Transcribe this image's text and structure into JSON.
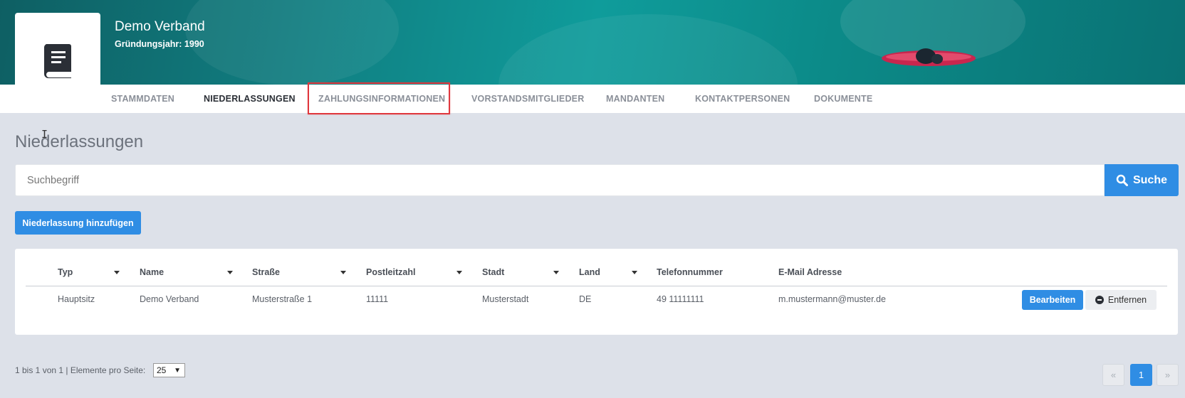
{
  "org": {
    "name": "Demo Verband",
    "founded": "Gründungsjahr: 1990"
  },
  "tabs": [
    {
      "label": "STAMMDATEN"
    },
    {
      "label": "NIEDERLASSUNGEN",
      "active": true
    },
    {
      "label": "ZAHLUNGSINFORMATIONEN",
      "highlighted": true
    },
    {
      "label": "VORSTANDSMITGLIEDER"
    },
    {
      "label": "MANDANTEN"
    },
    {
      "label": "KONTAKTPERSONEN"
    },
    {
      "label": "DOKUMENTE"
    }
  ],
  "page": {
    "title": "Niederlassungen"
  },
  "search": {
    "placeholder": "Suchbegriff",
    "button_label": "Suche"
  },
  "add_button_label": "Niederlassung hinzufügen",
  "table": {
    "columns": [
      "Typ",
      "Name",
      "Straße",
      "Postleitzahl",
      "Stadt",
      "Land",
      "Telefonnummer",
      "E-Mail Adresse"
    ],
    "rows": [
      {
        "typ": "Hauptsitz",
        "name": "Demo Verband",
        "strasse": "Musterstraße 1",
        "plz": "11111",
        "stadt": "Musterstadt",
        "land": "DE",
        "telefon": "49 11111111",
        "email": "m.mustermann@muster.de",
        "edit_label": "Bearbeiten",
        "remove_label": "Entfernen"
      }
    ]
  },
  "pagination": {
    "info": "1 bis 1 von 1 | Elemente pro Seite:",
    "per_page": "25",
    "prev": "«",
    "current": "1",
    "next": "»"
  },
  "colors": {
    "accent": "#2f8de4",
    "highlight_box": "#e0383e",
    "background": "#dde1e9"
  }
}
